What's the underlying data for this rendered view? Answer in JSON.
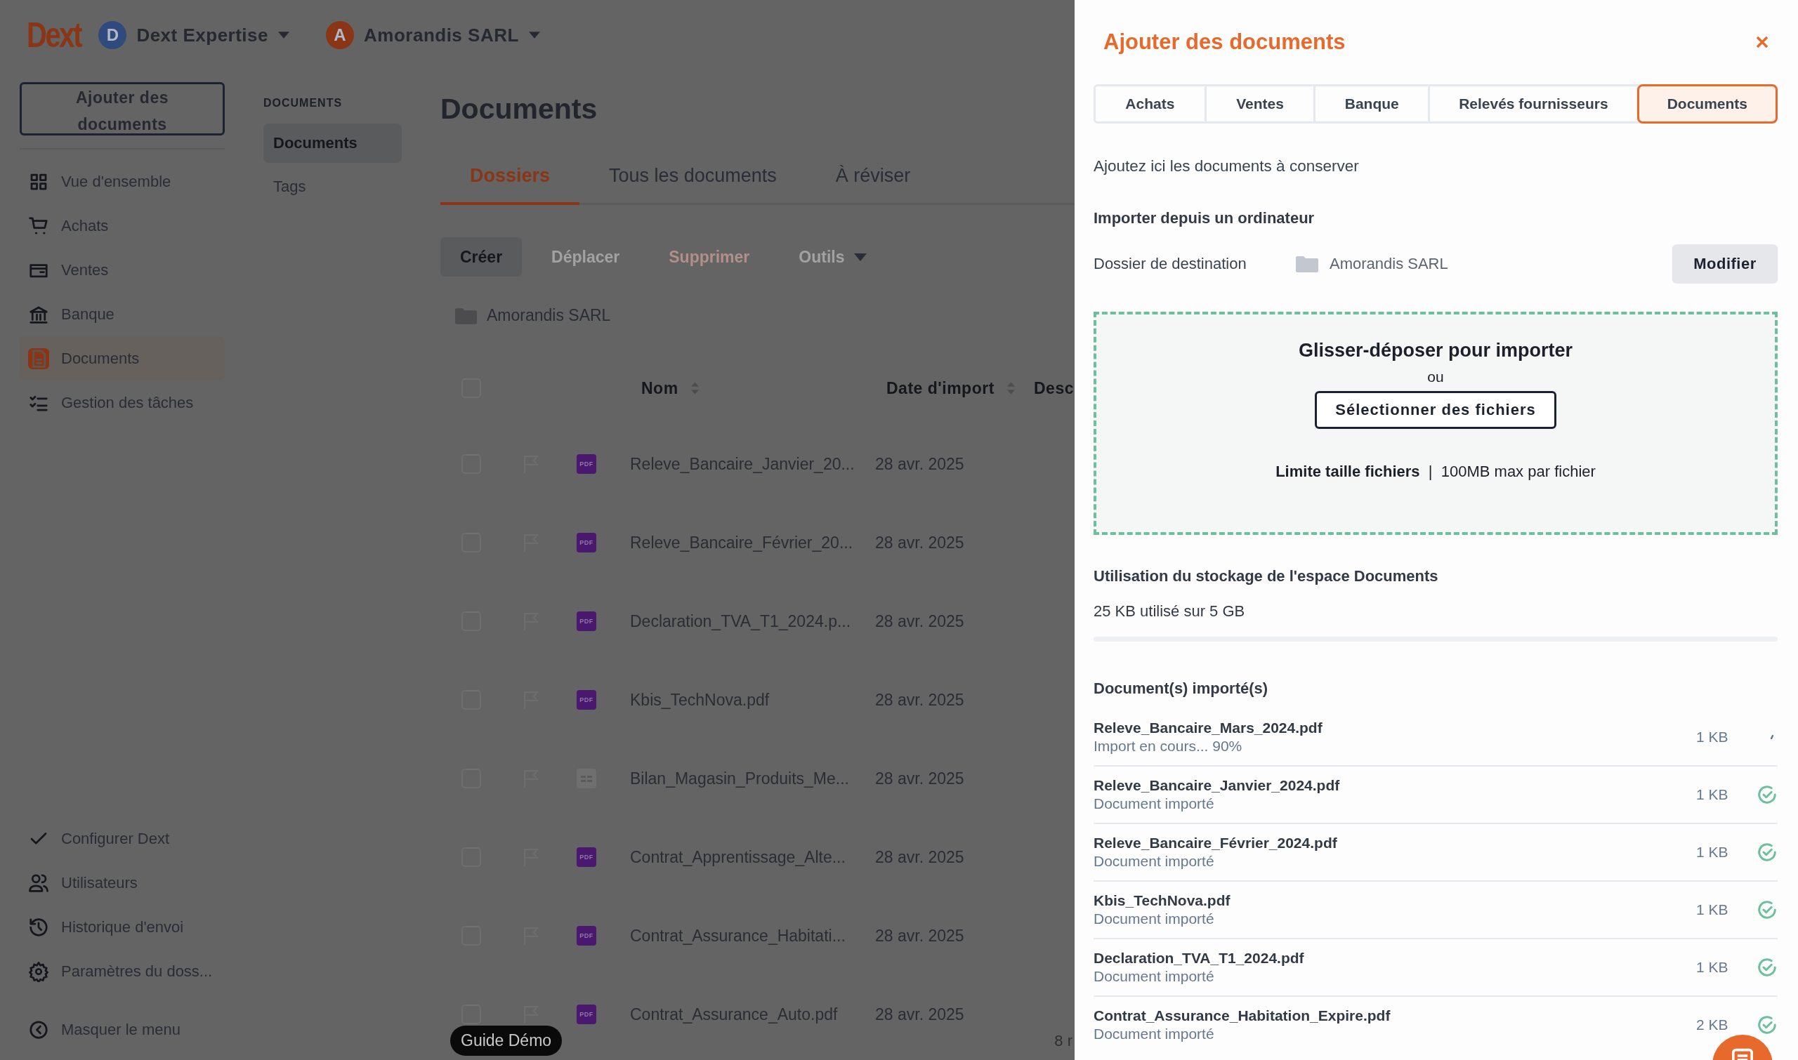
{
  "header": {
    "logo": "Dext",
    "workspaces": [
      {
        "initial": "D",
        "name": "Dext Expertise",
        "color": "#2f4a7c"
      },
      {
        "initial": "A",
        "name": "Amorandis SARL",
        "color": "#8a3516"
      }
    ]
  },
  "sidebar": {
    "add_button": "Ajouter des documents",
    "items": [
      {
        "label": "Vue d'ensemble",
        "selected": false
      },
      {
        "label": "Achats",
        "selected": false
      },
      {
        "label": "Ventes",
        "selected": false
      },
      {
        "label": "Banque",
        "selected": false
      },
      {
        "label": "Documents",
        "selected": true
      },
      {
        "label": "Gestion des tâches",
        "selected": false
      }
    ],
    "bottom_items": [
      {
        "label": "Configurer Dext"
      },
      {
        "label": "Utilisateurs"
      },
      {
        "label": "Historique d'envoi"
      },
      {
        "label": "Paramètres du doss..."
      }
    ],
    "collapse": "Masquer le menu"
  },
  "subnav": {
    "heading": "DOCUMENTS",
    "items": [
      {
        "label": "Documents",
        "selected": true
      },
      {
        "label": "Tags",
        "selected": false
      }
    ]
  },
  "main": {
    "title": "Documents",
    "tabs": [
      {
        "label": "Dossiers",
        "selected": true
      },
      {
        "label": "Tous les documents",
        "selected": false
      },
      {
        "label": "À réviser",
        "selected": false
      }
    ],
    "toolbar": [
      {
        "label": "Créer",
        "kind": "primary",
        "disabled": false
      },
      {
        "label": "Déplacer",
        "kind": "plain",
        "disabled": true
      },
      {
        "label": "Supprimer",
        "kind": "danger",
        "disabled": true
      },
      {
        "label": "Outils",
        "kind": "menu",
        "disabled": true
      }
    ],
    "folder": "Amorandis SARL",
    "table": {
      "all_checked": false,
      "columns": [
        "Nom",
        "Date d'import",
        "Desc"
      ],
      "rows": [
        {
          "checked": false,
          "kind": "pdf",
          "badge": "PDF",
          "name": "Releve_Bancaire_Janvier_20...",
          "date": "28 avr. 2025"
        },
        {
          "checked": false,
          "kind": "pdf",
          "badge": "PDF",
          "name": "Releve_Bancaire_Février_20...",
          "date": "28 avr. 2025"
        },
        {
          "checked": false,
          "kind": "pdf",
          "badge": "PDF",
          "name": "Declaration_TVA_T1_2024.p...",
          "date": "28 avr. 2025"
        },
        {
          "checked": false,
          "kind": "pdf",
          "badge": "PDF",
          "name": "Kbis_TechNova.pdf",
          "date": "28 avr. 2025"
        },
        {
          "checked": false,
          "kind": "sheet",
          "name": "Bilan_Magasin_Produits_Me...",
          "date": "28 avr. 2025"
        },
        {
          "checked": false,
          "kind": "pdf",
          "badge": "PDF",
          "name": "Contrat_Apprentissage_Alte...",
          "date": "28 avr. 2025"
        },
        {
          "checked": false,
          "kind": "pdf",
          "badge": "PDF",
          "name": "Contrat_Assurance_Habitati...",
          "date": "28 avr. 2025"
        },
        {
          "checked": false,
          "kind": "pdf",
          "badge": "PDF",
          "name": "Contrat_Assurance_Auto.pdf",
          "date": "28 avr. 2025"
        }
      ]
    },
    "guide": "Guide Démo",
    "pagination": "8 r"
  },
  "panel": {
    "title": "Ajouter des documents",
    "tabs": [
      {
        "label": "Achats",
        "selected": false
      },
      {
        "label": "Ventes",
        "selected": false
      },
      {
        "label": "Banque",
        "selected": false
      },
      {
        "label": "Relevés fournisseurs",
        "selected": false
      },
      {
        "label": "Documents",
        "selected": true
      }
    ],
    "intro": "Ajoutez ici les documents à conserver",
    "import_heading": "Importer depuis un ordinateur",
    "destination_label": "Dossier de destination",
    "destination_folder": "Amorandis SARL",
    "modify_button": "Modifier",
    "dropzone": {
      "title": "Glisser-déposer pour importer",
      "or": "ou",
      "select_button": "Sélectionner des fichiers",
      "limit": "**Limite taille fichiers**  |  100MB max par fichier"
    },
    "storage": {
      "heading": "Utilisation du stockage de l'espace Documents",
      "usage": "25 KB utilisé sur 5 GB"
    },
    "imported_heading": "Document(s) importé(s)",
    "imported": [
      {
        "name": "Releve_Bancaire_Mars_2024.pdf",
        "status": "Import en cours... 90%",
        "size": "1 KB",
        "kind": "uploading"
      },
      {
        "name": "Releve_Bancaire_Janvier_2024.pdf",
        "status": "Document importé",
        "size": "1 KB",
        "kind": "done"
      },
      {
        "name": "Releve_Bancaire_Février_2024.pdf",
        "status": "Document importé",
        "size": "1 KB",
        "kind": "done"
      },
      {
        "name": "Kbis_TechNova.pdf",
        "status": "Document importé",
        "size": "1 KB",
        "kind": "done"
      },
      {
        "name": "Declaration_TVA_T1_2024.pdf",
        "status": "Document importé",
        "size": "1 KB",
        "kind": "done"
      },
      {
        "name": "Contrat_Assurance_Habitation_Expire.pdf",
        "status": "Document importé",
        "size": "2 KB",
        "kind": "done"
      }
    ]
  }
}
